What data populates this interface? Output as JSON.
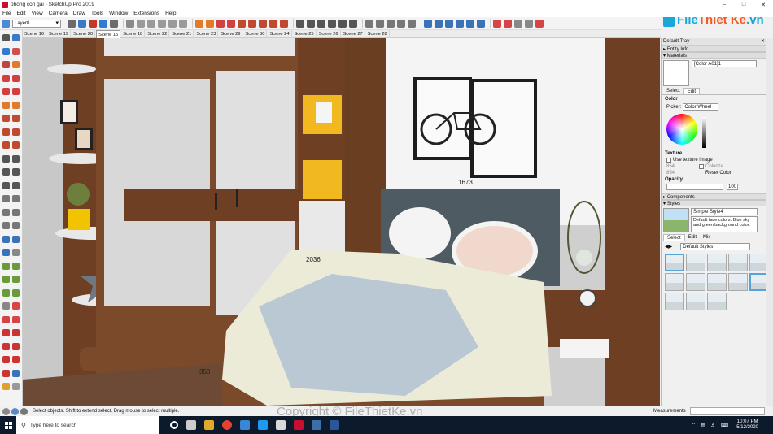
{
  "window": {
    "title": "phong con gai - SketchUp Pro 2019",
    "controls": [
      "–",
      "□",
      "✕"
    ]
  },
  "menu": [
    "File",
    "Edit",
    "View",
    "Camera",
    "Draw",
    "Tools",
    "Window",
    "Extensions",
    "Help"
  ],
  "toolbar": {
    "layer_value": "Layer0"
  },
  "scenes": [
    "Scene 16",
    "Scene 19",
    "Scene 20",
    "Scene 15",
    "Scene 18",
    "Scene 22",
    "Scene 21",
    "Scene 23",
    "Scene 29",
    "Scene 30",
    "Scene 24",
    "Scene 25",
    "Scene 26",
    "Scene 27",
    "Scene 28"
  ],
  "active_scene": "Scene 15",
  "viewport": {
    "dimension_labels": [
      "2036",
      "1673",
      "350"
    ]
  },
  "tray": {
    "title": "Default Tray",
    "sections": {
      "entity_info": "Entity Info",
      "materials": "Materials",
      "components": "Components",
      "styles": "Styles"
    },
    "materials": {
      "name": "[Color A01]1",
      "tabs": [
        "Select",
        "Edit"
      ],
      "color_label": "Color",
      "picker_label": "Picker:",
      "picker_value": "Color Wheel",
      "texture_label": "Texture",
      "use_texture": "Use texture image",
      "dim1": "854",
      "dim2": "854",
      "colorize": "Colorize",
      "reset_color": "Reset Color",
      "opacity_label": "Opacity",
      "opacity_value": "100"
    },
    "styles": {
      "name": "Simple Style4",
      "description": "Default face colors. Blue sky and green background color.",
      "tabs": [
        "Select",
        "Edit",
        "Mix"
      ],
      "library": "Default Styles"
    }
  },
  "status": {
    "hint": "Select objects. Shift to extend select. Drag mouse to select multiple.",
    "measurements_label": "Measurements"
  },
  "taskbar": {
    "search_placeholder": "Type here to search",
    "time": "10:07 PM",
    "date": "5/12/2020"
  },
  "watermark": "Copyright © FileThietKe.vn",
  "logo": {
    "part1": "File",
    "part2": "Thiết Kế",
    "part3": ".vn"
  },
  "colors": {
    "wood": "#7a4a2a",
    "wardrobe_panel": "#dcdcdc",
    "shelf_yellow": "#f2b820",
    "headboard": "#4e5b62",
    "taskbar": "#0d1a2b",
    "accent": "#1aa6d9"
  }
}
